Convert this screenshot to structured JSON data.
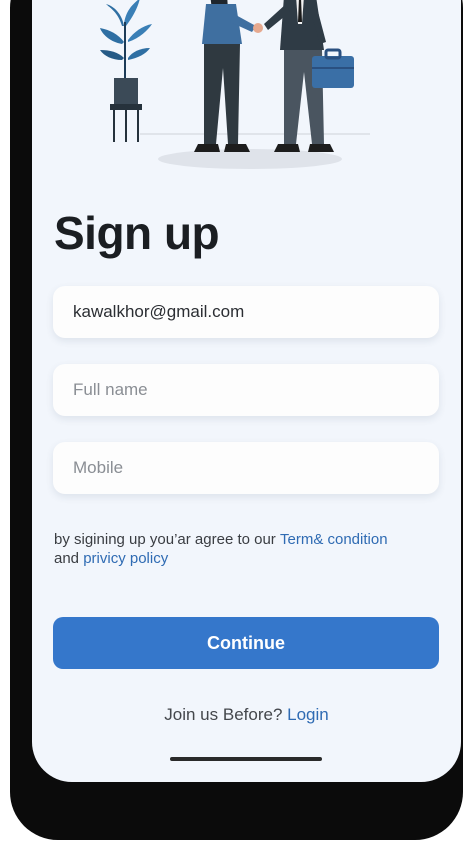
{
  "signup": {
    "title": "Sign up",
    "email_value": "kawalkhor@gmail.com",
    "full_name_placeholder": "Full name",
    "mobile_placeholder": "Mobile",
    "terms_prefix": "by sigining up you’ar agree to our ",
    "terms_link": "Term& condition",
    "terms_and": "and ",
    "privacy_link": "privicy policy",
    "continue_label": "Continue",
    "join_prompt": "Join us Before? ",
    "login_link": "Login"
  },
  "icons": {
    "back": "chevron-left-icon",
    "illustration": "handshake-illustration"
  },
  "colors": {
    "accent": "#3577cb",
    "link": "#2f6bb3",
    "background": "#f2f6fc",
    "title": "#1b1e22"
  }
}
